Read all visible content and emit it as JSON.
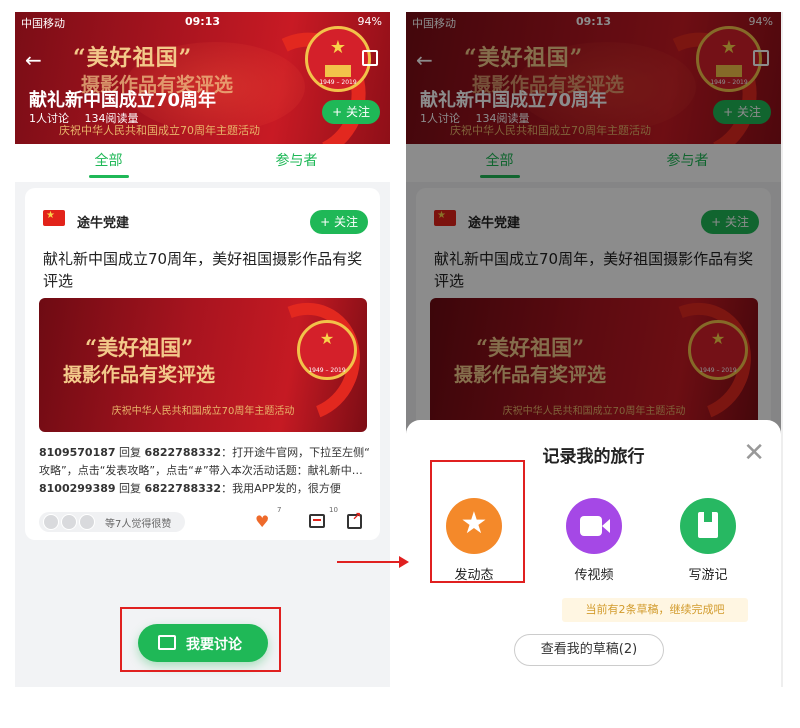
{
  "status": {
    "carrier": "中国移动",
    "time": "09:13",
    "battery": "94%"
  },
  "topic": {
    "banner_motto": "“美好祖国”",
    "banner_motto2": "摄影作品有奖评选",
    "banner_sub": "庆祝中华人民共和国成立70周年主题活动",
    "title": "献礼新中国成立70周年",
    "discussions": "1人讨论",
    "reads": "134阅读量",
    "follow_label": "+ 关注",
    "emblem_years": "1949 – 2019"
  },
  "tabs": [
    {
      "label": "全部",
      "active": true
    },
    {
      "label": "参与者",
      "active": false
    }
  ],
  "post": {
    "author": "途牛党建",
    "follow_label": "+ 关注",
    "headline": "献礼新中国成立70周年，美好祖国摄影作品有奖评选",
    "poster_motto": "“美好祖国”",
    "poster_motto2": "摄影作品有奖评选",
    "poster_sub": "庆祝中华人民共和国成立70周年主题活动",
    "poster_years": "1949 – 2019",
    "comments": [
      {
        "from": "8109570187",
        "verb": " 回复 ",
        "to": "6822788332",
        "text": "：打开途牛官网，下拉至左侧“游记"
      },
      {
        "from": "",
        "verb": "",
        "to": "",
        "text": "攻略”，点击“发表攻略”，点击“#”带入本次活动话题：献礼新中…"
      },
      {
        "from": "8100299389",
        "verb": " 回复 ",
        "to": "6822788332",
        "text": "：我用APP发的，很方便"
      }
    ],
    "likes_text": "等7人觉得很赞",
    "like_count": "7",
    "comment_count": "10"
  },
  "discuss_button": "我要讨论",
  "sheet": {
    "title": "记录我的旅行",
    "options": [
      {
        "label": "发动态",
        "icon": "star-face-icon",
        "color": "#f4892a"
      },
      {
        "label": "传视频",
        "icon": "video-icon",
        "color": "#a548e6"
      },
      {
        "label": "写游记",
        "icon": "notebook-icon",
        "color": "#27b862"
      }
    ],
    "drafts_tip": "当前有2条草稿，继续完成吧",
    "drafts_button": "查看我的草稿(2)"
  },
  "colors": {
    "accent": "#1fb857",
    "highlight": "#e02020"
  }
}
